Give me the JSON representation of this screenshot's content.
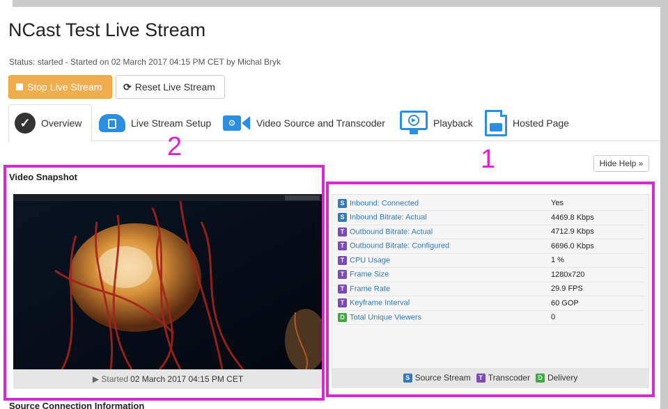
{
  "page": {
    "title": "NCast Test Live Stream",
    "status": "Status: started - Started on 02 March 2017 04:15 PM CET by Michal Bryk"
  },
  "actions": {
    "stop_label": "Stop Live Stream",
    "reset_label": "Reset Live Stream"
  },
  "tabs": [
    {
      "label": "Overview",
      "icon": "check-circle-icon",
      "active": true
    },
    {
      "label": "Live Stream Setup",
      "icon": "cloud-document-icon"
    },
    {
      "label": "Video Source and Transcoder",
      "icon": "camera-gear-icon"
    },
    {
      "label": "Playback",
      "icon": "monitor-play-icon"
    },
    {
      "label": "Hosted Page",
      "icon": "document-video-icon"
    }
  ],
  "annotations": {
    "label_1": "1",
    "label_2": "2",
    "highlight_color": "#d42ad0"
  },
  "help": {
    "hide_label": "Hide Help »"
  },
  "snapshot": {
    "title": "Video Snapshot",
    "caption_prefix": "▶ Started",
    "caption_date": "02 March 2017 04:15 PM CET"
  },
  "stats": [
    {
      "badge": "S",
      "label": "Inbound: Connected",
      "value": "Yes"
    },
    {
      "badge": "S",
      "label": "Inbound Bitrate: Actual",
      "value": "4469.8 Kbps"
    },
    {
      "badge": "T",
      "label": "Outbound Bitrate: Actual",
      "value": "4712.9 Kbps"
    },
    {
      "badge": "T",
      "label": "Outbound Bitrate: Configured",
      "value": "6696.0 Kbps"
    },
    {
      "badge": "T",
      "label": "CPU Usage",
      "value": "1 %"
    },
    {
      "badge": "T",
      "label": "Frame Size",
      "value": "1280x720"
    },
    {
      "badge": "T",
      "label": "Frame Rate",
      "value": "29.9 FPS"
    },
    {
      "badge": "T",
      "label": "Keyframe Interval",
      "value": "60 GOP"
    },
    {
      "badge": "D",
      "label": "Total Unique Viewers",
      "value": "0"
    }
  ],
  "legend": [
    {
      "badge": "S",
      "label": "Source Stream"
    },
    {
      "badge": "T",
      "label": "Transcoder"
    },
    {
      "badge": "D",
      "label": "Delivery"
    }
  ],
  "colors": {
    "source": "#337ab7",
    "transcoder": "#7a4bb3",
    "delivery": "#3fa83f",
    "stop_button": "#f0ad4e"
  },
  "sections": {
    "source_connection": "Source Connection Information"
  }
}
